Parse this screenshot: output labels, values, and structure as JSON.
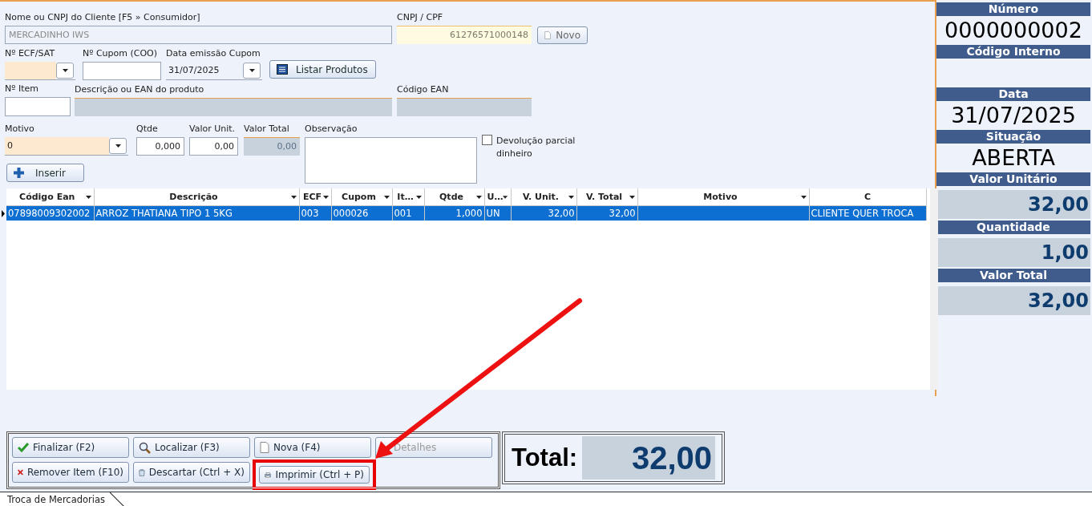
{
  "form": {
    "client": {
      "label": "Nome ou CNPJ do Cliente [F5 » Consumidor]",
      "value": "MERCADINHO IWS"
    },
    "cnpj": {
      "label": "CNPJ / CPF",
      "value": "61276571000148"
    },
    "new_button": "Novo",
    "ecf": {
      "label": "Nº ECF/SAT"
    },
    "coupon": {
      "label": "Nº Cupom (COO)"
    },
    "issue_date": {
      "label": "Data emissão Cupom",
      "value": "31/07/2025"
    },
    "list_button": "Listar Produtos",
    "item": {
      "label": "Nº Item"
    },
    "description": {
      "label": "Descrição ou EAN do produto"
    },
    "ean": {
      "label": "Código EAN"
    },
    "reason": {
      "label": "Motivo",
      "value": "0"
    },
    "qty": {
      "label": "Qtde",
      "value": "0,000"
    },
    "unit_value": {
      "label": "Valor Unit.",
      "value": "0,00"
    },
    "total_value": {
      "label": "Valor Total",
      "value": "0,00"
    },
    "note": {
      "label": "Observação"
    },
    "partial_refund": {
      "label": "Devolução parcial dinheiro",
      "checked": false
    },
    "insert_button": "Inserir"
  },
  "table": {
    "columns": [
      {
        "label": "Código Ean"
      },
      {
        "label": "Descrição"
      },
      {
        "label": "ECF"
      },
      {
        "label": "Cupom"
      },
      {
        "label": "It…"
      },
      {
        "label": "Qtde"
      },
      {
        "label": "U…"
      },
      {
        "label": "V. Unit."
      },
      {
        "label": "V. Total"
      },
      {
        "label": "Motivo"
      },
      {
        "label": "C"
      }
    ],
    "rows": [
      {
        "selected": true,
        "cells": [
          "07898009302002",
          "ARROZ THATIANA TIPO 1 5KG",
          "003",
          "000026",
          "001",
          "1,000",
          "UN",
          "32,00",
          "32,00",
          "",
          "CLIENTE QUER TROCA"
        ]
      }
    ]
  },
  "actions": [
    {
      "label": "Finalizar (F2)",
      "kind": "confirm",
      "disabled": false,
      "highlighted": false
    },
    {
      "label": "Localizar (F3)",
      "kind": "search",
      "disabled": false,
      "highlighted": false
    },
    {
      "label": "Nova (F4)",
      "kind": "new",
      "disabled": false,
      "highlighted": false
    },
    {
      "label": "Detalhes",
      "kind": "details",
      "disabled": true,
      "highlighted": false
    },
    {
      "label": "Remover Item (F10)",
      "kind": "remove",
      "disabled": false,
      "highlighted": false
    },
    {
      "label": "Descartar (Ctrl + X)",
      "kind": "discard",
      "disabled": false,
      "highlighted": false
    },
    {
      "label": "Imprimir (Ctrl + P)",
      "kind": "print",
      "disabled": false,
      "highlighted": true
    }
  ],
  "total": {
    "label": "Total:",
    "value": "32,00"
  },
  "info_panel": [
    {
      "heading": "Número",
      "kind": "plain",
      "value": "0000000002"
    },
    {
      "heading": "Código Interno",
      "kind": "plain"
    },
    {
      "heading": "Data",
      "kind": "plain",
      "value": "31/07/2025"
    },
    {
      "heading": "Situação",
      "kind": "plain",
      "value": "ABERTA"
    },
    {
      "heading": "Valor Unitário",
      "kind": "boxed",
      "value": "32,00"
    },
    {
      "heading": "Quantidade",
      "kind": "boxed",
      "value": "1,00"
    },
    {
      "heading": "Valor Total",
      "kind": "boxed",
      "value": "32,00"
    }
  ],
  "status_tab": "Troca de Mercadorias"
}
